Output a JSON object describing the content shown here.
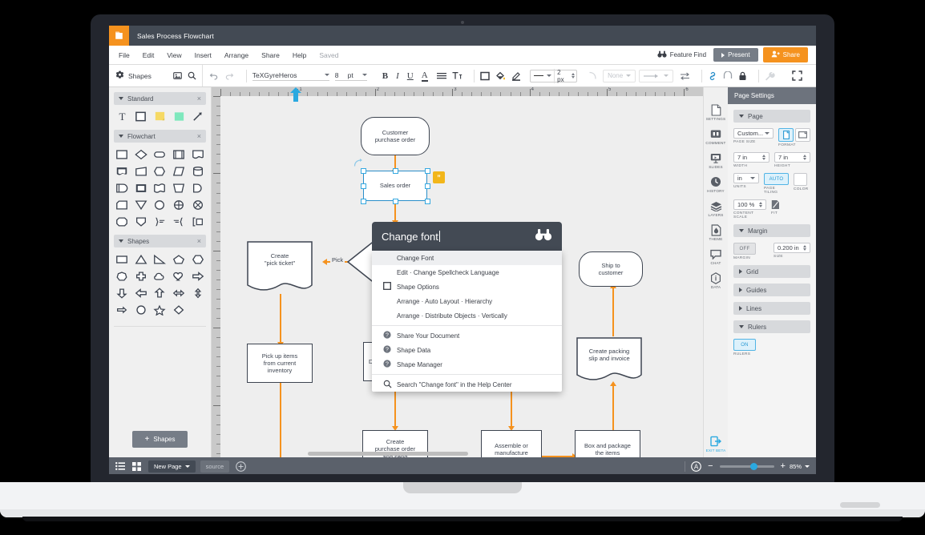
{
  "app": {
    "document_title": "Sales Process Flowchart",
    "menus": [
      "File",
      "Edit",
      "View",
      "Insert",
      "Arrange",
      "Share",
      "Help"
    ],
    "saved_status": "Saved",
    "feature_find": "Feature Find",
    "present_button": "Present",
    "share_button": "Share"
  },
  "toolbar": {
    "shapes_label": "Shapes",
    "font_family": "TeXGyreHeros",
    "font_size": "8",
    "font_size_unit": "pt",
    "bold": "B",
    "italic": "I",
    "underline": "U",
    "text_color": "A",
    "line_width": "2 px",
    "arrow_style": "None"
  },
  "left_panel": {
    "sections": [
      {
        "title": "Standard",
        "close": "×"
      },
      {
        "title": "Flowchart",
        "close": "×"
      },
      {
        "title": "Shapes",
        "close": "×"
      }
    ],
    "add_shapes_button": "Shapes",
    "add_shapes_plus": "+"
  },
  "right_rail": [
    {
      "label": "SETTINGS",
      "icon": "page-icon"
    },
    {
      "label": "COMMENT",
      "icon": "comment-icon"
    },
    {
      "label": "SLIDES",
      "icon": "slides-icon"
    },
    {
      "label": "HISTORY",
      "icon": "clock-icon"
    },
    {
      "label": "LAYERS",
      "icon": "layers-icon"
    },
    {
      "label": "THEME",
      "icon": "theme-icon"
    },
    {
      "label": "CHAT",
      "icon": "chat-icon"
    },
    {
      "label": "DATA",
      "icon": "info-icon"
    },
    {
      "label": "EXIT BETA",
      "icon": "exit-icon"
    }
  ],
  "right_panel": {
    "header": "Page Settings",
    "sections": {
      "page": "Page",
      "margin": "Margin",
      "grid": "Grid",
      "guides": "Guides",
      "lines": "Lines",
      "rulers": "Rulers"
    },
    "page_size_value": "Custom...",
    "page_size_caption": "PAGE SIZE",
    "format_caption": "FORMAT",
    "width_value": "7 in",
    "width_caption": "WIDTH",
    "height_value": "7 in",
    "height_caption": "HEIGHT",
    "units_value": "in",
    "units_caption": "UNITS",
    "page_tiling_value": "AUTO",
    "page_tiling_caption": "PAGE TILING",
    "color_caption": "COLOR",
    "content_scale_value": "100 %",
    "content_scale_caption": "CONTENT SCALE",
    "fit_caption": "FIT",
    "margin_value": "OFF",
    "margin_caption": "MARGIN",
    "margin_size_value": "0.200 in",
    "margin_size_caption": "SIZE",
    "rulers_value": "ON",
    "rulers_caption": "RULERS"
  },
  "palette": {
    "query": "Change font",
    "icon": "binoculars-icon",
    "items": [
      {
        "label": "Change Font",
        "icon": null,
        "selected": true
      },
      {
        "label": "Edit · Change Spellcheck Language",
        "icon": null,
        "selected": false
      },
      {
        "label": "Shape Options",
        "icon": "square-icon",
        "selected": false
      },
      {
        "label": "Arrange · Auto Layout · Hierarchy",
        "icon": null,
        "selected": false
      },
      {
        "label": "Arrange · Distribute Objects · Vertically",
        "icon": null,
        "selected": false
      }
    ],
    "help_items": [
      {
        "label": "Share Your Document",
        "icon": "help-icon"
      },
      {
        "label": "Shape Data",
        "icon": "help-icon"
      },
      {
        "label": "Shape Manager",
        "icon": "help-icon"
      }
    ],
    "search_item": {
      "label": "Search \"Change font\" in the Help Center",
      "icon": "search-icon"
    }
  },
  "canvas": {
    "ruler_numbers": [
      "1",
      "2",
      "3",
      "4",
      "5",
      "6"
    ],
    "nodes": [
      {
        "id": "n1",
        "text": "Customer\npurchase order",
        "shape": "rounded"
      },
      {
        "id": "n2",
        "text": "Sales order",
        "shape": "rect",
        "selected": true
      },
      {
        "id": "n3",
        "text": "Create\n\"pick ticket\"",
        "shape": "document"
      },
      {
        "id": "n4",
        "text": "Pick up items\nfrom current\ninventory",
        "shape": "rect"
      },
      {
        "id": "n5",
        "text": "De",
        "shape": "rect"
      },
      {
        "id": "n6",
        "text": "Create\npurchase order\nand send",
        "shape": "rect"
      },
      {
        "id": "n7",
        "text": "Assemble or\nmanufacture",
        "shape": "rect"
      },
      {
        "id": "n8",
        "text": "Box and package\nthe items",
        "shape": "rect"
      },
      {
        "id": "n9",
        "text": "Create packing\nslip and invoice",
        "shape": "document"
      },
      {
        "id": "n10",
        "text": "Ship to\ncustomer",
        "shape": "rounded"
      }
    ],
    "edge_labels": [
      "Pick"
    ],
    "note_flag": "”"
  },
  "status_bar": {
    "new_page_button": "New Page",
    "source_tab": "source",
    "add_page": "+",
    "zoom_level": "85%",
    "zoom_minus": "−",
    "zoom_plus": "+"
  }
}
